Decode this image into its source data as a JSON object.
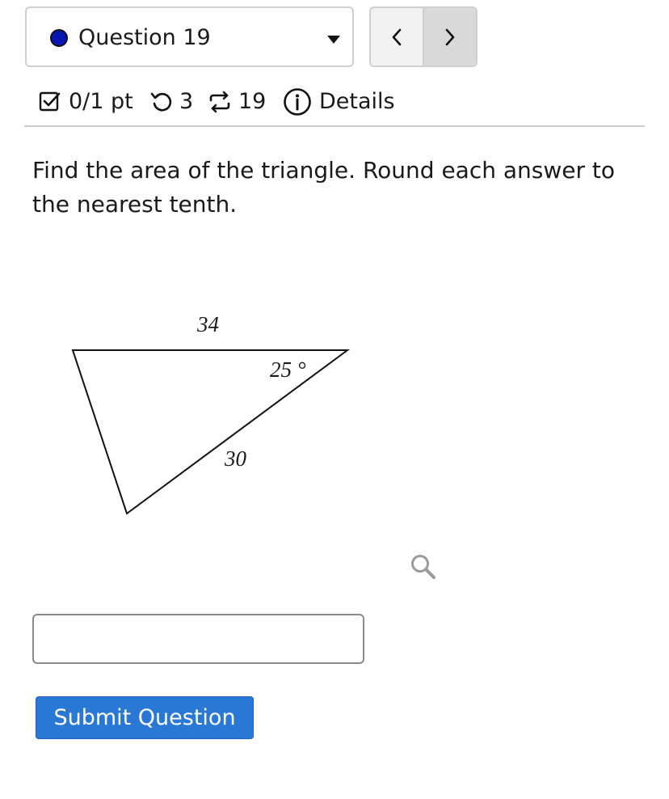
{
  "question_selector": {
    "label": "Question 19",
    "status_color": "#0a16b4"
  },
  "navigation": {
    "prev_icon": "chevron-left-icon",
    "next_icon": "chevron-right-icon"
  },
  "meta": {
    "score": "0/1 pt",
    "attempts": "3",
    "versions": "19",
    "details_label": "Details"
  },
  "prompt": {
    "text": "Find the area of the triangle. Round each answer to the nearest tenth."
  },
  "figure": {
    "top_side_label": "34",
    "angle_label": "25 °",
    "slant_side_label": "30"
  },
  "answer": {
    "value": "",
    "placeholder": ""
  },
  "submit": {
    "label": "Submit Question",
    "color": "#2a78d6"
  }
}
